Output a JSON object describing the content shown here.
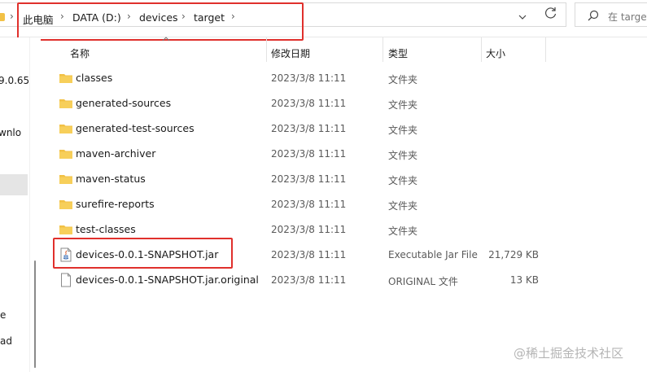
{
  "address_bar": {
    "crumbs": [
      "此电脑",
      "DATA (D:)",
      "devices",
      "target"
    ],
    "separator": "›",
    "dropdown_glyph": "⌄"
  },
  "search": {
    "placeholder": "在 target"
  },
  "nav_pane": {
    "items": [
      "9.0.65",
      "wnlo",
      "e",
      "ad"
    ]
  },
  "columns": {
    "name": "名称",
    "modified": "修改日期",
    "type": "类型",
    "size": "大小"
  },
  "files": [
    {
      "name": "classes",
      "modified": "2023/3/8 11:11",
      "type": "文件夹",
      "size": "",
      "icon": "folder-icon"
    },
    {
      "name": "generated-sources",
      "modified": "2023/3/8 11:11",
      "type": "文件夹",
      "size": "",
      "icon": "folder-icon"
    },
    {
      "name": "generated-test-sources",
      "modified": "2023/3/8 11:11",
      "type": "文件夹",
      "size": "",
      "icon": "folder-icon"
    },
    {
      "name": "maven-archiver",
      "modified": "2023/3/8 11:11",
      "type": "文件夹",
      "size": "",
      "icon": "folder-icon"
    },
    {
      "name": "maven-status",
      "modified": "2023/3/8 11:11",
      "type": "文件夹",
      "size": "",
      "icon": "folder-icon"
    },
    {
      "name": "surefire-reports",
      "modified": "2023/3/8 11:11",
      "type": "文件夹",
      "size": "",
      "icon": "folder-icon"
    },
    {
      "name": "test-classes",
      "modified": "2023/3/8 11:11",
      "type": "文件夹",
      "size": "",
      "icon": "folder-icon"
    },
    {
      "name": "devices-0.0.1-SNAPSHOT.jar",
      "modified": "2023/3/8 11:11",
      "type": "Executable Jar File",
      "size": "21,729 KB",
      "icon": "jar-file-icon"
    },
    {
      "name": "devices-0.0.1-SNAPSHOT.jar.original",
      "modified": "2023/3/8 11:11",
      "type": "ORIGINAL 文件",
      "size": "13 KB",
      "icon": "file-icon"
    }
  ],
  "watermark": "@稀土掘金技术社区",
  "colors": {
    "folder": "#f2c146",
    "highlight": "#e0302c",
    "selected": "#e5e5e5"
  }
}
